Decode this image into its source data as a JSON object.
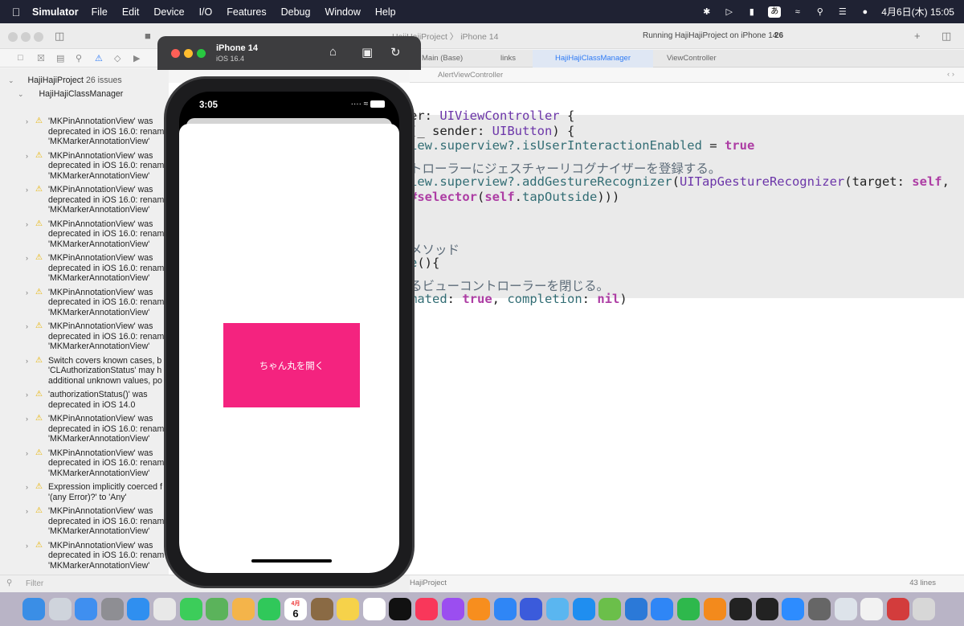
{
  "menubar": {
    "app_name": "Simulator",
    "menus": [
      "File",
      "Edit",
      "Device",
      "I/O",
      "Features",
      "Debug",
      "Window",
      "Help"
    ],
    "ime": "あ",
    "datetime": "4月6日(木)  15:05"
  },
  "toolbar": {
    "scheme": "HajiHajiProject 〉 iPhone 14",
    "activity": "Running HajiHajiProject on iPhone 14",
    "issue_count": "26"
  },
  "tabs": [
    "Main (Base)",
    "links",
    "HajiHajiClassManager",
    "ViewController"
  ],
  "jumpbar": "AlertViewController",
  "navigator": {
    "root": "HajiHajiProject",
    "root_badge": "26 issues",
    "group": "HajiHajiClassManager",
    "issues": [
      {
        "text": "'MKPinAnnotationView' was\ndeprecated in iOS 16.0: renam\n'MKMarkerAnnotationView'"
      },
      {
        "text": "'MKPinAnnotationView' was\ndeprecated in iOS 16.0: renam\n'MKMarkerAnnotationView'"
      },
      {
        "text": "'MKPinAnnotationView' was\ndeprecated in iOS 16.0: renam\n'MKMarkerAnnotationView'"
      },
      {
        "text": "'MKPinAnnotationView' was\ndeprecated in iOS 16.0: renam\n'MKMarkerAnnotationView'"
      },
      {
        "text": "'MKPinAnnotationView' was\ndeprecated in iOS 16.0: renam\n'MKMarkerAnnotationView'"
      },
      {
        "text": "'MKPinAnnotationView' was\ndeprecated in iOS 16.0: renam\n'MKMarkerAnnotationView'"
      },
      {
        "text": "'MKPinAnnotationView' was\ndeprecated in iOS 16.0: renam\n'MKMarkerAnnotationView'"
      },
      {
        "text": "Switch covers known cases, b\n'CLAuthorizationStatus' may h\nadditional unknown values, po"
      },
      {
        "text": "'authorizationStatus()' was\ndeprecated in iOS 14.0"
      },
      {
        "text": "'MKPinAnnotationView' was\ndeprecated in iOS 16.0: renam\n'MKMarkerAnnotationView'"
      },
      {
        "text": "'MKPinAnnotationView' was\ndeprecated in iOS 16.0: renam\n'MKMarkerAnnotationView'"
      },
      {
        "text": "Expression implicitly coerced f\n'(any Error)?' to 'Any'"
      },
      {
        "text": "'MKPinAnnotationView' was\ndeprecated in iOS 16.0: renam\n'MKMarkerAnnotationView'"
      },
      {
        "text": "'MKPinAnnotationView' was\ndeprecated in iOS 16.0: renam\n'MKMarkerAnnotationView'"
      },
      {
        "text": "'MKPinAnnotationView' was"
      }
    ],
    "filter_placeholder": "Filter"
  },
  "code": {
    "lines": [
      {
        "parts": [
          [
            "",
            "er: "
          ],
          [
            "ty",
            "UIViewController"
          ],
          [
            "",
            " {"
          ]
        ]
      },
      {
        "parts": [
          [
            "",
            "(_ sender: "
          ],
          [
            "ty",
            "UIButton"
          ],
          [
            "",
            ") {"
          ]
        ]
      },
      {
        "parts": [
          [
            "fn",
            "iew.superview?.isUserInteractionEnabled"
          ],
          [
            "",
            " = "
          ],
          [
            "kw",
            "true"
          ]
        ]
      },
      {
        "parts": [
          [
            "cm",
            "トローラーにジェスチャーリコグナイザーを登録する。"
          ]
        ]
      },
      {
        "parts": [
          [
            "fn",
            "iew.superview?.addGestureRecognizer"
          ],
          [
            "",
            "("
          ],
          [
            "ty",
            "UITapGestureRecognizer"
          ],
          [
            "",
            "(target: "
          ],
          [
            "kw",
            "self"
          ],
          [
            "",
            ","
          ]
        ]
      },
      {
        "parts": [
          [
            "kw",
            "#selector"
          ],
          [
            "",
            "("
          ],
          [
            "kw",
            "self"
          ],
          [
            "",
            "."
          ],
          [
            "fn",
            "tapOutside"
          ],
          [
            "",
            ")))"
          ]
        ]
      },
      {
        "parts": [
          [
            "cm",
            "メソッド"
          ]
        ]
      },
      {
        "parts": [
          [
            "fn",
            "e"
          ],
          [
            "",
            "(){"
          ]
        ]
      },
      {
        "parts": [
          [
            "cm",
            "るビューコントローラーを閉じる。"
          ]
        ]
      },
      {
        "parts": [
          [
            "fn",
            "mated"
          ],
          [
            "",
            ": "
          ],
          [
            "kw",
            "true"
          ],
          [
            "",
            ", "
          ],
          [
            "fn",
            "completion"
          ],
          [
            "",
            ": "
          ],
          [
            "kw",
            "nil"
          ],
          [
            "",
            ")"
          ]
        ]
      }
    ]
  },
  "statusbar": {
    "path": "HajiProject",
    "lines": "43 lines"
  },
  "simulator": {
    "device": "iPhone 14",
    "os": "iOS 16.4",
    "time": "3:05",
    "button_label": "ちゃん丸を開く",
    "button_color": "#f4237f"
  },
  "dock": {
    "calendar_month": "4月",
    "calendar_day": "6",
    "apps": [
      "finder",
      "launchpad",
      "mail",
      "system-settings",
      "safari",
      "chrome",
      "messages",
      "maps",
      "photos",
      "facetime",
      "calendar",
      "notes-brown",
      "notes",
      "reminders",
      "tv",
      "music",
      "podcasts",
      "books",
      "xcode",
      "instruments",
      "app-folder",
      "app-store",
      "numbers-green",
      "vscode",
      "keynote",
      "numbers",
      "pages",
      "github",
      "terminal",
      "zoom",
      "calculator",
      "preview",
      "textedit",
      "kotoeri",
      "trash"
    ]
  }
}
